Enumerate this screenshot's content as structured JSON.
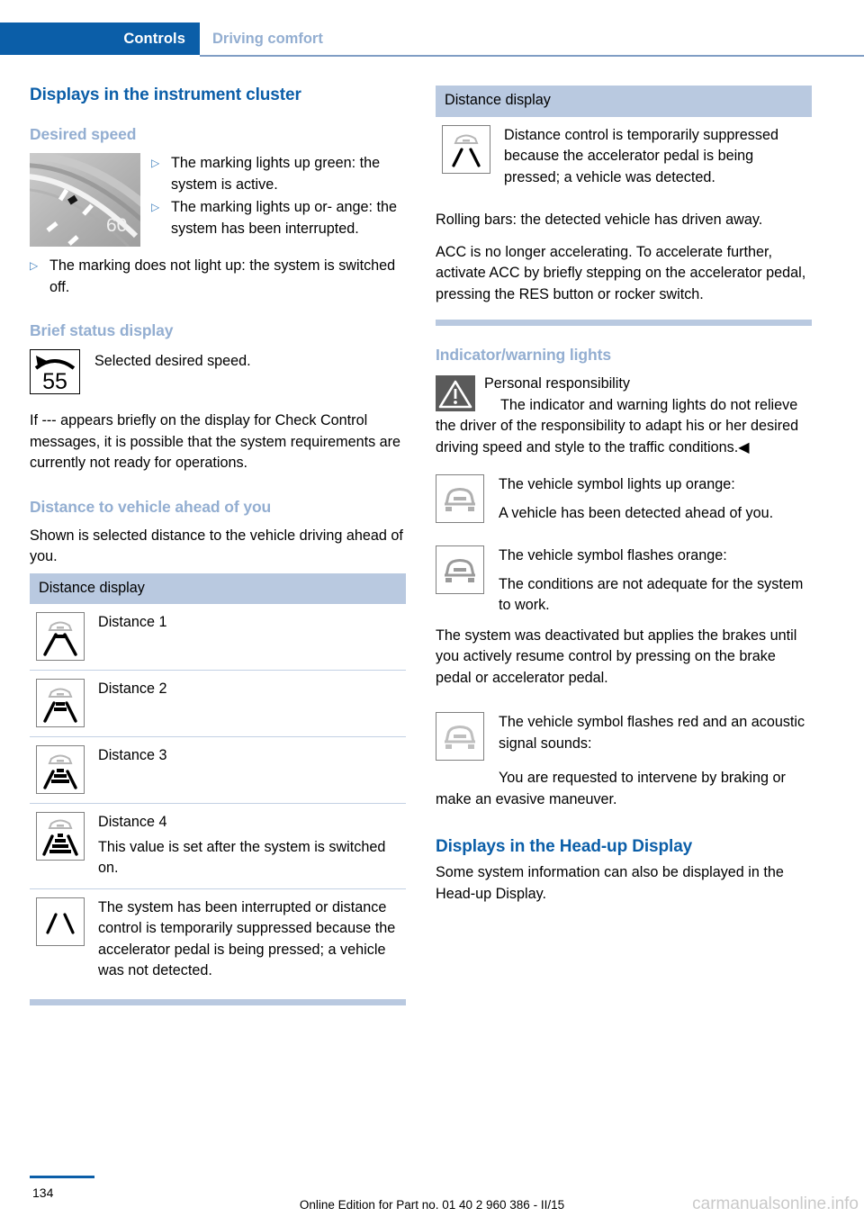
{
  "header": {
    "active_tab": "Controls",
    "inactive_tab": "Driving comfort",
    "accent_color": "#0b5ea8",
    "muted_color": "#93aed1"
  },
  "left_column": {
    "chapter_title": "Displays in the instrument cluster",
    "desired_speed": {
      "heading": "Desired speed",
      "gauge_label": "60",
      "bullets": [
        "The marking lights up green: the system is active.",
        "The marking lights up or-\nange: the system has been interrupted.",
        "The marking does not light up: the system is switched off."
      ]
    },
    "brief_status": {
      "heading": "Brief status display",
      "icon_value": "55",
      "icon_caption": "Selected desired speed.",
      "paragraph": "If --- appears briefly on the display for Check Control messages, it is possible that the system requirements are currently not ready for operations."
    },
    "distance_to_vehicle": {
      "heading": "Distance to vehicle ahead of you",
      "intro": "Shown is selected distance to the vehicle driving ahead of you.",
      "table_header": "Distance display",
      "rows": [
        {
          "icon": "distance-1-icon",
          "bars": 1,
          "label": "Distance 1",
          "note": ""
        },
        {
          "icon": "distance-2-icon",
          "bars": 2,
          "label": "Distance 2",
          "note": ""
        },
        {
          "icon": "distance-3-icon",
          "bars": 3,
          "label": "Distance 3",
          "note": ""
        },
        {
          "icon": "distance-4-icon",
          "bars": 4,
          "label": "Distance 4",
          "note": "This value is set after the system is switched on."
        },
        {
          "icon": "no-vehicle-icon",
          "bars": 0,
          "label": "The system has been interrupted or distance control is temporarily suppressed because the accelerator pedal is being pressed; a vehicle was not detected.",
          "note": ""
        }
      ]
    }
  },
  "right_column": {
    "distance_table": {
      "table_header": "Distance display",
      "row_icon": "vehicle-detected-suppressed-icon",
      "row_text": "Distance control is temporarily suppressed because the accelerator pedal is being pressed; a vehicle was detected."
    },
    "paragraphs": [
      "Rolling bars: the detected vehicle has driven away.",
      "ACC is no longer accelerating. To accelerate further, activate ACC by briefly stepping on the accelerator pedal, pressing the RES button or rocker switch."
    ],
    "indicator_lights": {
      "heading": "Indicator/warning lights",
      "warning": {
        "icon": "warning-triangle-icon",
        "title": "Personal responsibility",
        "body": "The indicator and warning lights do not relieve the driver of the responsibility to adapt his or her desired driving speed and style to the traffic conditions.",
        "end_mark": "◀"
      },
      "items": [
        {
          "icon": "vehicle-symbol-orange-icon",
          "icon_color": "#b0b0b0",
          "title": "The vehicle symbol lights up orange:",
          "body": "A vehicle has been detected ahead of you."
        },
        {
          "icon": "vehicle-symbol-flashing-orange-icon",
          "icon_color": "#9a9a9a",
          "title": "The vehicle symbol flashes orange:",
          "body": "The conditions are not adequate for the system to work."
        },
        {
          "icon": "vehicle-symbol-flashing-red-icon",
          "icon_color": "#bfbfbf",
          "title": "The vehicle symbol flashes red and an acoustic signal sounds:",
          "body": "You are requested to intervene by braking or make an evasive maneuver."
        }
      ],
      "mid_paragraph": "The system was deactivated but applies the brakes until you actively resume control by pressing on the brake pedal or accelerator pedal."
    },
    "head_up_display": {
      "heading": "Displays in the Head-up Display",
      "body": "Some system information can also be displayed in the Head-up Display."
    }
  },
  "footer": {
    "page_number": "134",
    "edition_text": "Online Edition for Part no. 01 40 2 960 386 - II/15",
    "watermark": "carmanualsonline.info"
  }
}
